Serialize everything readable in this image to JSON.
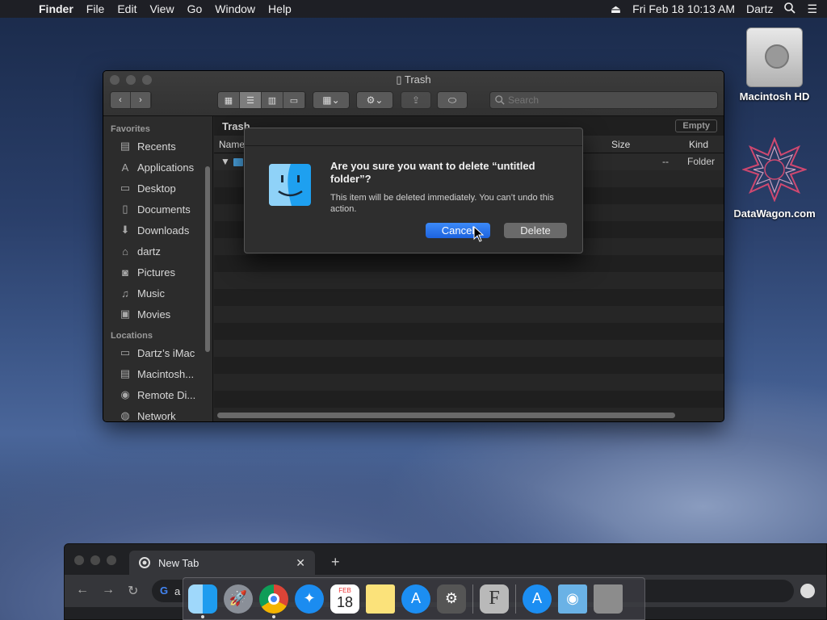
{
  "menubar": {
    "app_name": "Finder",
    "menus": [
      "File",
      "Edit",
      "View",
      "Go",
      "Window",
      "Help"
    ],
    "datetime": "Fri Feb 18  10:13 AM",
    "user": "Dartz"
  },
  "desktop": {
    "icons": [
      "Macintosh HD",
      "DataWagon.com"
    ]
  },
  "finder": {
    "title": "Trash",
    "search_placeholder": "Search",
    "path": "Trash",
    "empty_label": "Empty",
    "sidebar": {
      "favorites_header": "Favorites",
      "favorites": [
        "Recents",
        "Applications",
        "Desktop",
        "Documents",
        "Downloads",
        "dartz",
        "Pictures",
        "Music",
        "Movies"
      ],
      "locations_header": "Locations",
      "locations": [
        "Dartz’s iMac",
        "Macintosh...",
        "Remote Di...",
        "Network"
      ]
    },
    "columns": {
      "name": "Name",
      "size": "Size",
      "kind": "Kind"
    },
    "row": {
      "size": "--",
      "kind": "Folder"
    }
  },
  "dialog": {
    "title": "Are you sure you want to delete “untitled folder”?",
    "message": "This item will be deleted immediately. You can’t undo this action.",
    "cancel_label": "Cancel",
    "delete_label": "Delete"
  },
  "chrome": {
    "tab_title": "New Tab",
    "omnibox_partial": "a"
  },
  "dock": {
    "calendar_month": "FEB",
    "calendar_day": "18",
    "items": [
      "finder-icon",
      "launchpad-icon",
      "chrome-icon",
      "safari-icon",
      "calendar-icon",
      "notes-icon",
      "app-store-icon",
      "system-preferences-icon",
      "font-book-icon",
      "app-store-folder-icon",
      "downloads-folder-icon",
      "trash-icon"
    ]
  },
  "colors": {
    "accent_blue": "#1d63de",
    "window_bg": "#262626"
  }
}
